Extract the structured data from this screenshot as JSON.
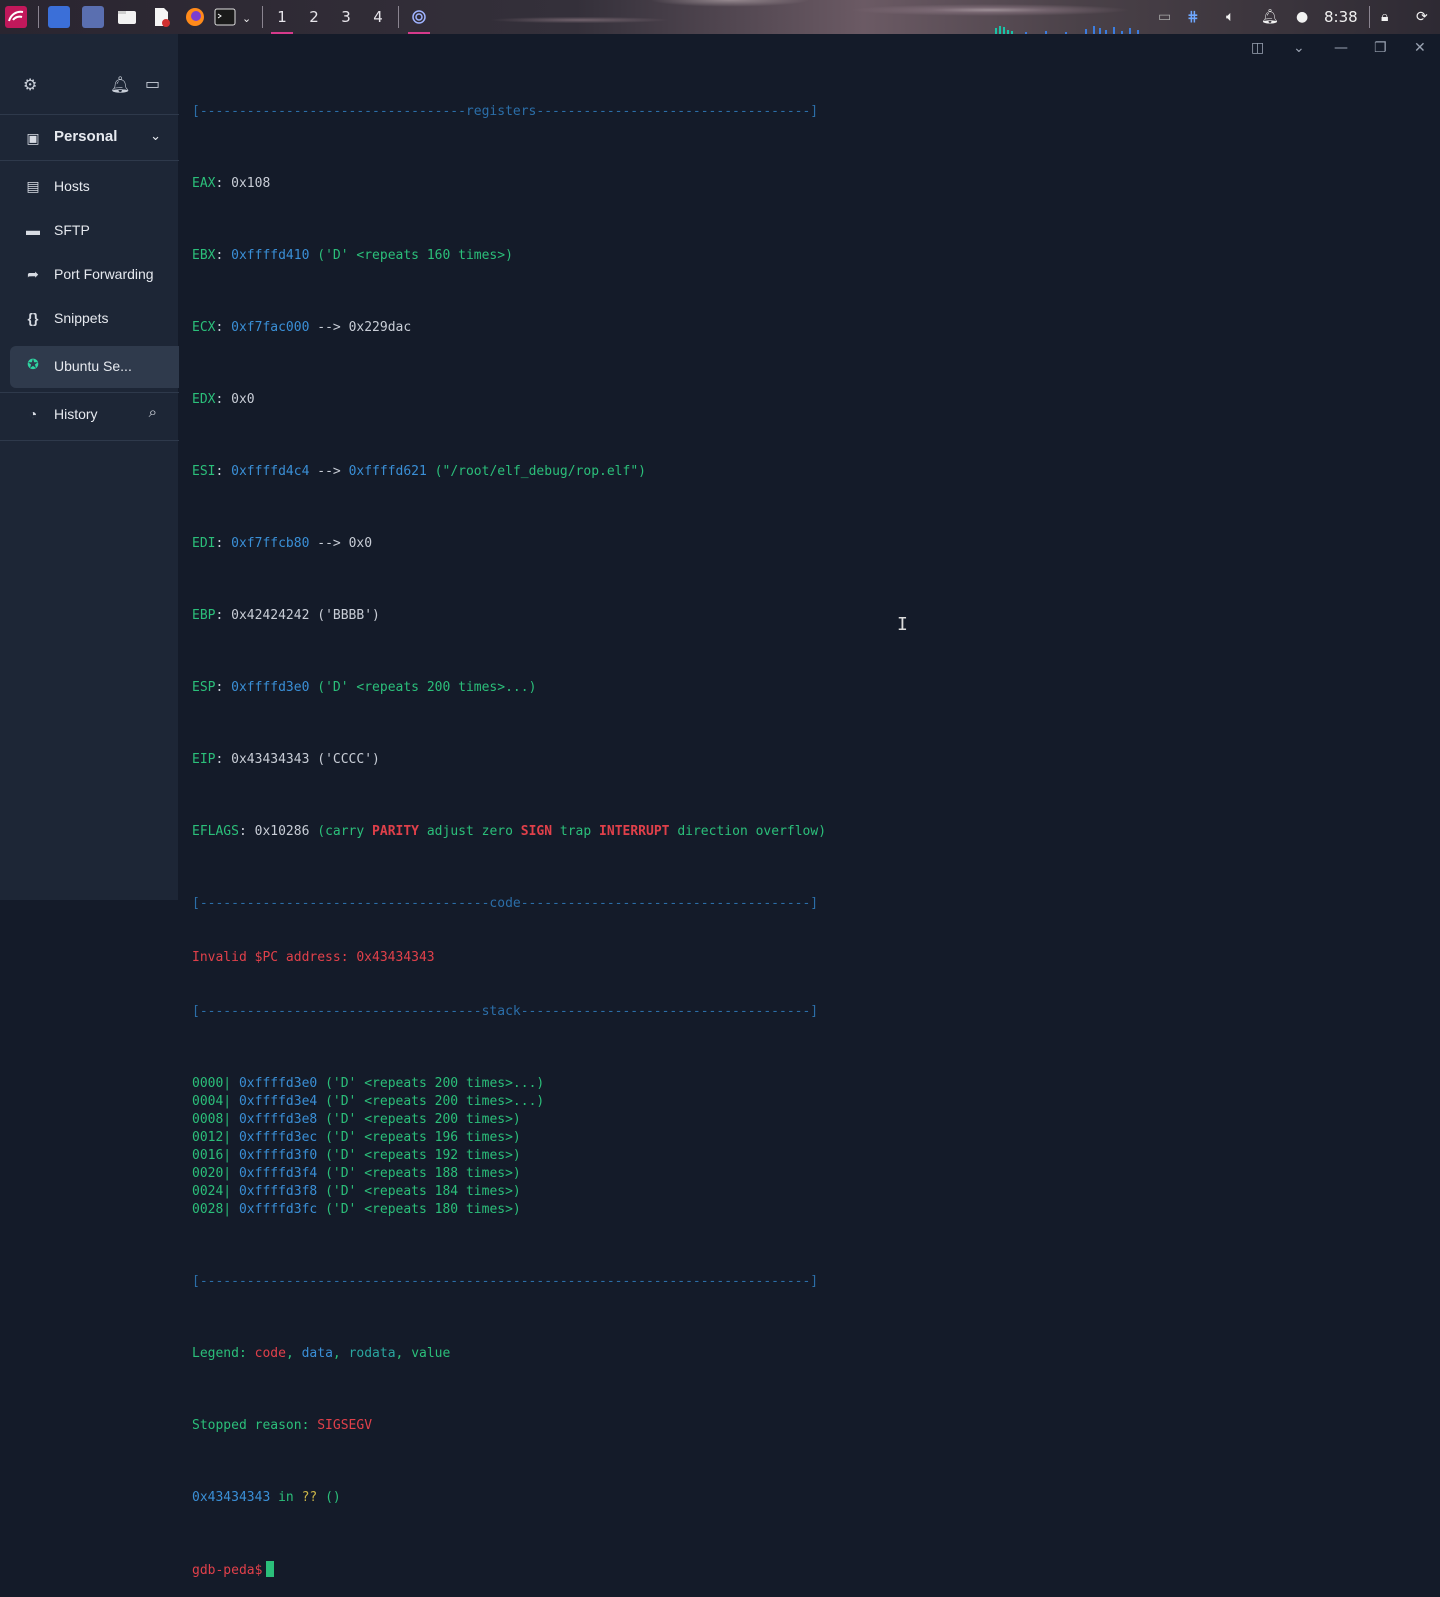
{
  "taskbar": {
    "workspaces": [
      "1",
      "2",
      "3",
      "4"
    ],
    "clock": "8:38"
  },
  "sidebar": {
    "group_label": "Personal",
    "items": [
      {
        "label": "Hosts",
        "icon": "hosts-icon"
      },
      {
        "label": "SFTP",
        "icon": "folder-icon"
      },
      {
        "label": "Port Forwarding",
        "icon": "forward-arrow-icon"
      },
      {
        "label": "Snippets",
        "icon": "braces-icon"
      }
    ],
    "active_session": "Ubuntu Se...",
    "history_label": "History"
  },
  "terminal": {
    "sep_registers": "[----------------------------------registers-----------------------------------]",
    "eax": {
      "name": "EAX",
      "value": "0x108"
    },
    "ebx": {
      "name": "EBX",
      "addr": "0xffffd410",
      "rest": "('D' <repeats 160 times>)"
    },
    "ecx": {
      "name": "ECX",
      "addr": "0xf7fac000",
      "arrow": "-->",
      "target": "0x229dac"
    },
    "edx": {
      "name": "EDX",
      "value": "0x0"
    },
    "esi": {
      "name": "ESI",
      "addr": "0xffffd4c4",
      "arrow": "-->",
      "addr2": "0xffffd621",
      "rest": "(\"/root/elf_debug/rop.elf\")"
    },
    "edi": {
      "name": "EDI",
      "addr": "0xf7ffcb80",
      "arrow": "-->",
      "target": "0x0"
    },
    "ebp": {
      "name": "EBP",
      "value": "0x42424242",
      "rest": "('BBBB')"
    },
    "esp": {
      "name": "ESP",
      "addr": "0xffffd3e0",
      "rest": "('D' <repeats 200 times>...)"
    },
    "eip": {
      "name": "EIP",
      "value": "0x43434343",
      "rest": "('CCCC')"
    },
    "eflags": {
      "name": "EFLAGS",
      "value": "0x10286",
      "open": "(carry",
      "parity": "PARITY",
      "mid": "adjust zero",
      "sign": "SIGN",
      "trap": "trap",
      "interrupt": "INTERRUPT",
      "tail": "direction overflow)"
    },
    "sep_code": "[-------------------------------------code-------------------------------------]",
    "invalid_pc": "Invalid $PC address: 0x43434343",
    "sep_stack": "[------------------------------------stack-------------------------------------]",
    "stack": [
      {
        "offset": "0000|",
        "addr": "0xffffd3e0",
        "val": "('D' <repeats 200 times>...)"
      },
      {
        "offset": "0004|",
        "addr": "0xffffd3e4",
        "val": "('D' <repeats 200 times>...)"
      },
      {
        "offset": "0008|",
        "addr": "0xffffd3e8",
        "val": "('D' <repeats 200 times>)"
      },
      {
        "offset": "0012|",
        "addr": "0xffffd3ec",
        "val": "('D' <repeats 196 times>)"
      },
      {
        "offset": "0016|",
        "addr": "0xffffd3f0",
        "val": "('D' <repeats 192 times>)"
      },
      {
        "offset": "0020|",
        "addr": "0xffffd3f4",
        "val": "('D' <repeats 188 times>)"
      },
      {
        "offset": "0024|",
        "addr": "0xffffd3f8",
        "val": "('D' <repeats 184 times>)"
      },
      {
        "offset": "0028|",
        "addr": "0xffffd3fc",
        "val": "('D' <repeats 180 times>)"
      }
    ],
    "sep_end": "[------------------------------------------------------------------------------]",
    "legend": {
      "prefix": "Legend:",
      "code": "code",
      "data": "data",
      "rodata": "rodata",
      "value": "value"
    },
    "stopped": {
      "prefix": "Stopped reason:",
      "reason": "SIGSEGV"
    },
    "frame": {
      "addr": "0x43434343",
      "in": "in",
      "func": "??",
      "args": "()"
    },
    "prompt": "gdb-peda$"
  }
}
